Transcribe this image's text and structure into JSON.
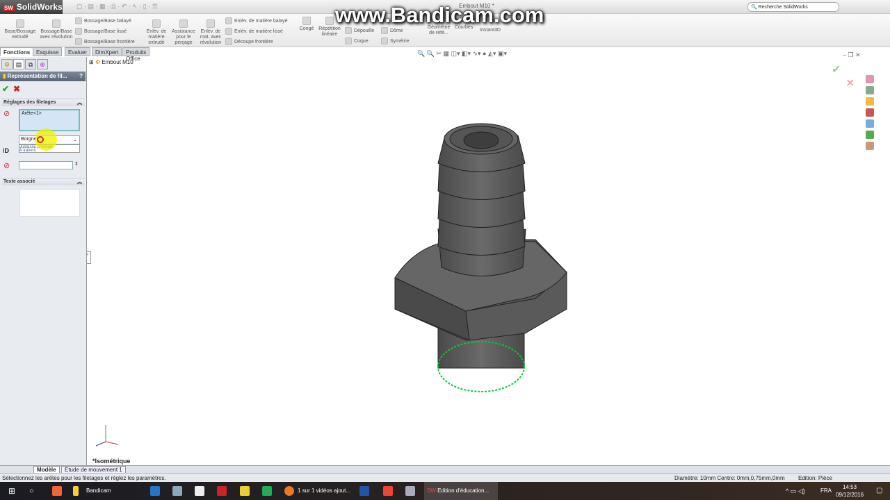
{
  "app": {
    "name": "SolidWorks",
    "doc_title": "Embout M10 *",
    "search_placeholder": "Recherche SolidWorks",
    "watermark": "www.Bandicam.com"
  },
  "ribbon": {
    "large": [
      "Base/Bossage extrudé",
      "Bossage/Base avec révolution",
      "Enlèv. de matière extrudé",
      "Assistance pour le perçage",
      "Enlèv. de mat. avec révolution",
      "Congé",
      "Répétition linéaire",
      "Géométrie de réfé...",
      "Courbes",
      "Instant3D"
    ],
    "small": [
      "Bossage/Base balayé",
      "Bossage/Base lissé",
      "Bossage/Base frontière",
      "Enlèv. de matière balayé",
      "Enlèv. de matière lissé",
      "Découpe frontière",
      "Dépouille",
      "Coque",
      "Dôme",
      "Symétrie"
    ]
  },
  "tabs": [
    "Fonctions",
    "Esquisse",
    "Evaluer",
    "DimXpert",
    "Produits Office"
  ],
  "panel": {
    "title": "Représentation de fil...",
    "help": "?",
    "section1": "Réglages des filetages",
    "edge_value": "Arête<1>",
    "end_condition": "Borgne",
    "dropdown_options": [
      "Jusqu'au prochain",
      "A travers"
    ],
    "depth_label": "D",
    "section2": "Texte associé"
  },
  "tree": {
    "root": "Embout M10"
  },
  "view": {
    "orientation": "*Isométrique"
  },
  "bottom_tabs": [
    "Modèle",
    "Etude de mouvement 1"
  ],
  "status": {
    "message": "Sélectionnez les arêtes pour les filetages et réglez les paramètres.",
    "measure": "Diamètre: 10mm  Centre: 0mm,0,75mm,0mm",
    "mode": "Edition: Pièce"
  },
  "taskbar": {
    "items": [
      "Bandicam",
      "1 sur 1 vidéos ajout...",
      "Edition d'éducation..."
    ],
    "lang": "FRA",
    "time": "14:53",
    "date": "09/12/2016"
  },
  "colors": {
    "selection": "#00cc33",
    "accent": "#5b6578",
    "part": "#5a5a5a"
  }
}
